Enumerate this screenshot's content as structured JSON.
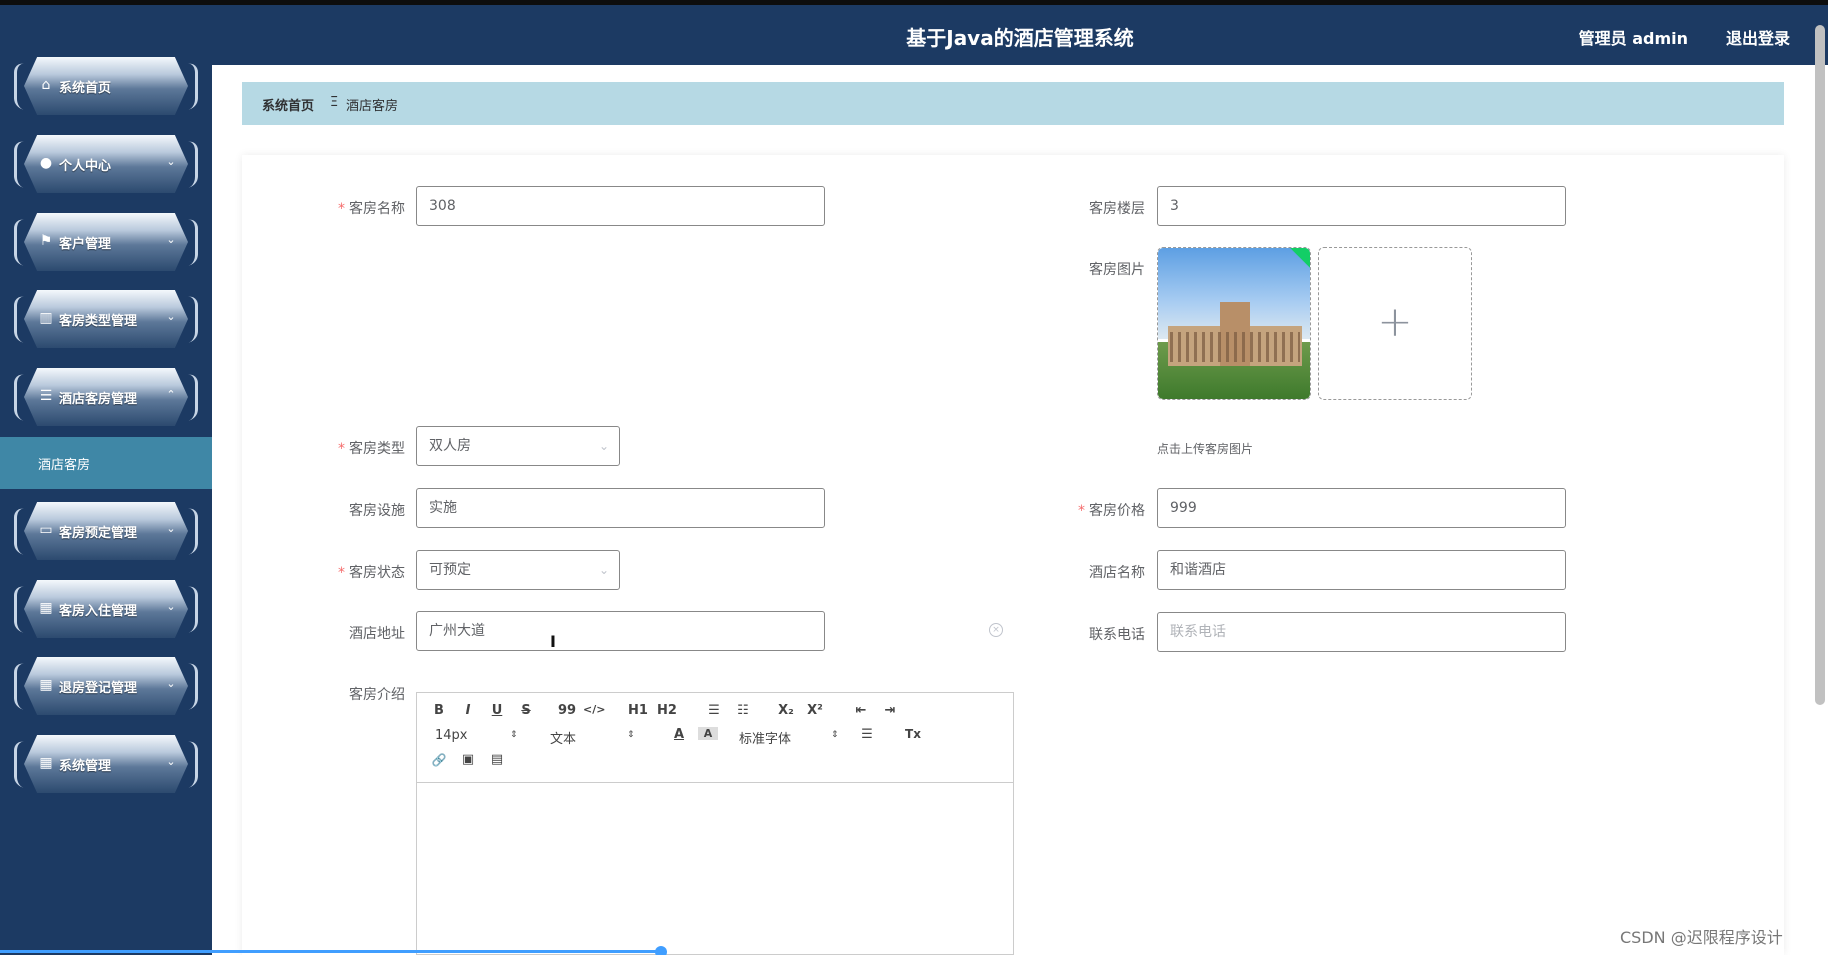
{
  "app": {
    "title": "基于Java的酒店管理系统",
    "user_label": "管理员 admin",
    "logout_label": "退出登录"
  },
  "sidebar": {
    "items": [
      {
        "label": "系统首页",
        "icon": "home-icon",
        "expanded": null
      },
      {
        "label": "个人中心",
        "icon": "user-icon",
        "expanded": false
      },
      {
        "label": "客户管理",
        "icon": "flag-icon",
        "expanded": false
      },
      {
        "label": "客房类型管理",
        "icon": "columns-icon",
        "expanded": false
      },
      {
        "label": "酒店客房管理",
        "icon": "list-icon",
        "expanded": true
      },
      {
        "label": "客房预定管理",
        "icon": "monitor-icon",
        "expanded": false
      },
      {
        "label": "客房入住管理",
        "icon": "grid-icon",
        "expanded": false
      },
      {
        "label": "退房登记管理",
        "icon": "grid-icon",
        "expanded": false
      },
      {
        "label": "系统管理",
        "icon": "grid-icon",
        "expanded": false
      }
    ],
    "active_submenu": "酒店客房"
  },
  "breadcrumb": {
    "home": "系统首页",
    "separator": "Ξ",
    "current": "酒店客房"
  },
  "form": {
    "room_name": {
      "label": "客房名称",
      "value": "308",
      "required": true
    },
    "floor": {
      "label": "客房楼层",
      "value": "3",
      "required": false
    },
    "picture": {
      "label": "客房图片",
      "tip": "点击上传客房图片",
      "plus": "+"
    },
    "room_type": {
      "label": "客房类型",
      "value": "双人房",
      "required": true
    },
    "facilities": {
      "label": "客房设施",
      "value": "实施",
      "required": false
    },
    "price": {
      "label": "客房价格",
      "value": "999",
      "required": true
    },
    "status": {
      "label": "客房状态",
      "value": "可预定",
      "required": true
    },
    "hotel_name": {
      "label": "酒店名称",
      "value": "和谐酒店",
      "required": false
    },
    "address": {
      "label": "酒店地址",
      "value": "广州大道",
      "required": false
    },
    "phone": {
      "label": "联系电话",
      "placeholder": "联系电话",
      "required": false
    },
    "intro": {
      "label": "客房介绍"
    }
  },
  "editor": {
    "font_size": "14px",
    "header_select": "文本",
    "font_family": "标准字体",
    "tools": {
      "bold": "B",
      "italic": "I",
      "underline": "U",
      "strike": "S",
      "quote": "99",
      "code": "</>",
      "h1": "H1",
      "h2": "H2",
      "ol": "☰",
      "ul": "☷",
      "sub": "X₂",
      "sup": "X²",
      "outdent": "⇤",
      "indent": "⇥",
      "color": "A",
      "background": "A",
      "align": "☰",
      "clean": "Tx",
      "link": "🔗",
      "image": "▣",
      "video": "▤"
    }
  },
  "watermark": "CSDN @迟限程序设计",
  "colors": {
    "sidebar": "#1c3a63",
    "breadcrumb": "#b6d9e4",
    "active": "#3f87a6",
    "required": "#f56c6c"
  }
}
